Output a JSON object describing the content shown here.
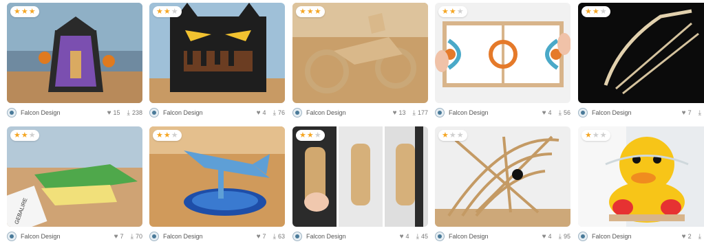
{
  "colors": {
    "star_on": "#f5a623",
    "star_off": "#cfcfcf"
  },
  "icons": {
    "like": "heart-icon",
    "download": "download-icon"
  },
  "cards": [
    {
      "rating": 3,
      "author": "Falcon Design",
      "likes": "15",
      "downloads": "238"
    },
    {
      "rating": 2,
      "author": "Falcon Design",
      "likes": "4",
      "downloads": "76"
    },
    {
      "rating": 3,
      "author": "Falcon Design",
      "likes": "13",
      "downloads": "177"
    },
    {
      "rating": 2,
      "author": "Falcon Design",
      "likes": "4",
      "downloads": "56"
    },
    {
      "rating": 2,
      "author": "Falcon Design",
      "likes": "7",
      "downloads": ""
    },
    {
      "rating": 2,
      "author": "Falcon Design",
      "likes": "7",
      "downloads": "70",
      "photo_text": "GEBALIRE"
    },
    {
      "rating": 2,
      "author": "Falcon Design",
      "likes": "7",
      "downloads": "63"
    },
    {
      "rating": 2,
      "author": "Falcon Design",
      "likes": "4",
      "downloads": "45"
    },
    {
      "rating": 1,
      "author": "Falcon Design",
      "likes": "4",
      "downloads": "95"
    },
    {
      "rating": 1,
      "author": "Falcon Design",
      "likes": "2",
      "downloads": ""
    }
  ]
}
